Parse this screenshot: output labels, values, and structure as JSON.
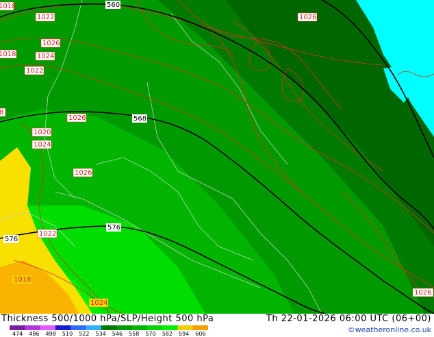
{
  "map": {
    "pressure_labels": [
      {
        "text": "1018"
      },
      {
        "text": "1022"
      },
      {
        "text": "1026"
      },
      {
        "text": "1018"
      },
      {
        "text": "1024"
      },
      {
        "text": "1022"
      },
      {
        "text": "8"
      },
      {
        "text": "1026"
      },
      {
        "text": "1020"
      },
      {
        "text": "1024"
      },
      {
        "text": "1026"
      },
      {
        "text": "1022"
      },
      {
        "text": "1018"
      },
      {
        "text": "1024"
      },
      {
        "text": "1026"
      },
      {
        "text": "1026"
      }
    ],
    "height_labels": [
      {
        "text": "560"
      },
      {
        "text": "568"
      },
      {
        "text": "576"
      },
      {
        "text": "576"
      }
    ]
  },
  "footer": {
    "title": "Thickness 500/1000 hPa/SLP/Height 500 hPa",
    "datetime": "Th 22-01-2026 06:00 UTC (06+00)",
    "credit": "©weatheronline.co.uk",
    "scale_ticks": [
      "474",
      "486",
      "498",
      "510",
      "522",
      "534",
      "546",
      "558",
      "570",
      "582",
      "594",
      "606"
    ],
    "scale_colors": [
      "#7a1fa0",
      "#b03adf",
      "#e15cff",
      "#1b1bd6",
      "#2f6cff",
      "#2fb0ff",
      "#007a00",
      "#009800",
      "#00b600",
      "#00d400",
      "#00ee00",
      "#f0d000",
      "#f8a000"
    ]
  },
  "colors": {
    "sea": "#00ffff",
    "isobar": "#d03818",
    "height_contour": "#000000"
  }
}
